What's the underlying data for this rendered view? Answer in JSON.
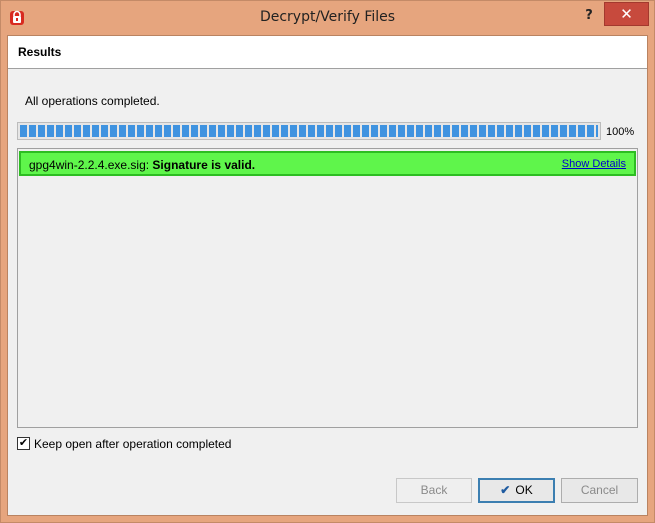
{
  "window": {
    "title": "Decrypt/Verify Files",
    "help_glyph": "?",
    "close_glyph": "✕"
  },
  "header": {
    "title": "Results"
  },
  "status": {
    "message": "All operations completed.",
    "progress_percent": 100,
    "progress_label": "100%"
  },
  "results": [
    {
      "file": "gpg4win-2.2.4.exe.sig:",
      "status": "Signature is valid.",
      "link": "Show Details",
      "color": "#5ff54b"
    }
  ],
  "options": {
    "keep_open_label": "Keep open after operation completed",
    "keep_open_checked": true,
    "check_glyph": "✔"
  },
  "buttons": {
    "back": "Back",
    "ok": "OK",
    "ok_glyph": "✔",
    "cancel": "Cancel"
  },
  "colors": {
    "title_bg": "#e6a57e",
    "close_bg": "#c74a3d",
    "progress": "#3f93e0",
    "valid_bg": "#5ff54b"
  }
}
